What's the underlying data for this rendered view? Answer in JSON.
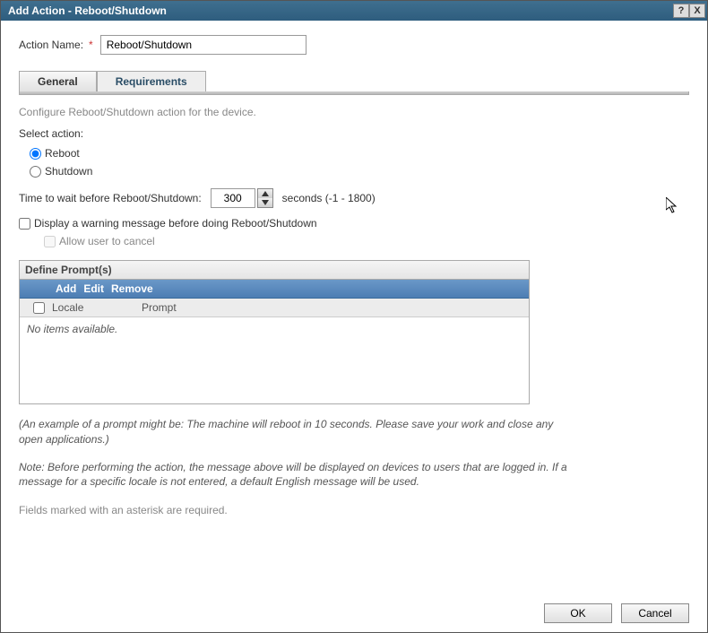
{
  "titlebar": {
    "title": "Add Action - Reboot/Shutdown",
    "help_label": "?",
    "close_label": "X"
  },
  "form": {
    "action_name_label": "Action Name:",
    "action_name_value": "Reboot/Shutdown"
  },
  "tabs": {
    "general": "General",
    "requirements": "Requirements"
  },
  "general": {
    "description": "Configure Reboot/Shutdown action for the device.",
    "select_action_label": "Select action:",
    "reboot_label": "Reboot",
    "shutdown_label": "Shutdown",
    "time_wait_label": "Time to wait before Reboot/Shutdown:",
    "time_wait_value": "300",
    "time_wait_units": "seconds (-1 - 1800)",
    "display_warning_label": "Display a warning message before doing Reboot/Shutdown",
    "allow_cancel_label": "Allow user to cancel",
    "prompts": {
      "header": "Define Prompt(s)",
      "toolbar": {
        "add": "Add",
        "edit": "Edit",
        "remove": "Remove"
      },
      "columns": {
        "locale": "Locale",
        "prompt": "Prompt"
      },
      "empty": "No items available."
    },
    "example_text": "(An example of a prompt might be: The machine will reboot in 10 seconds. Please save your work and close any open applications.)",
    "note_text": "Note: Before performing the action, the message above will be displayed on devices to users that are logged in. If a message for a specific locale is not entered, a default English message will be used."
  },
  "footer": {
    "required_note": "Fields marked with an asterisk are required.",
    "ok": "OK",
    "cancel": "Cancel"
  }
}
